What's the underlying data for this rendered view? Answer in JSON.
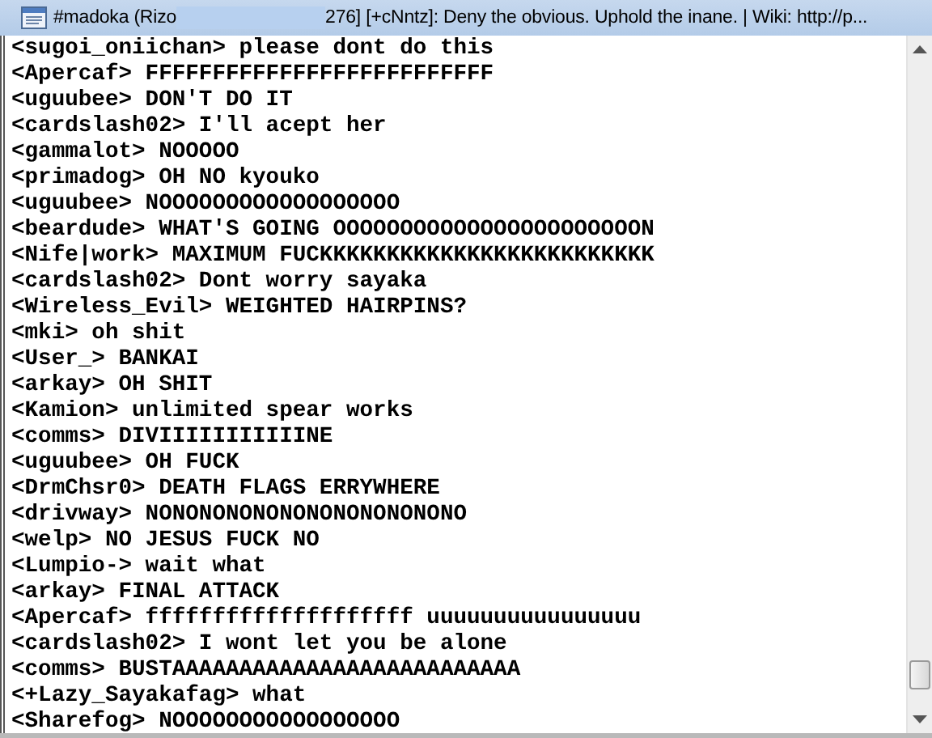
{
  "window": {
    "title_start": "#madoka (Rizo",
    "title_end": "276] [+cNntz]: Deny the obvious. Uphold the inane. | Wiki: http://p..."
  },
  "messages": [
    {
      "nick": "<sugoi_oniichan>",
      "text": "please dont do this"
    },
    {
      "nick": "<Apercaf>",
      "text": "FFFFFFFFFFFFFFFFFFFFFFFFFF"
    },
    {
      "nick": "<uguubee>",
      "text": "DON'T DO IT"
    },
    {
      "nick": "<cardslash02>",
      "text": "I'll acept her"
    },
    {
      "nick": "<gammalot>",
      "text": "NOOOOO"
    },
    {
      "nick": "<primadog>",
      "text": "OH NO kyouko"
    },
    {
      "nick": "<uguubee>",
      "text": "NOOOOOOOOOOOOOOOOOO"
    },
    {
      "nick": "<beardude>",
      "text": "WHAT'S GOING OOOOOOOOOOOOOOOOOOOOOOON"
    },
    {
      "nick": "<Nife|work>",
      "text": "MAXIMUM FUCKKKKKKKKKKKKKKKKKKKKKKKKK"
    },
    {
      "nick": "<cardslash02>",
      "text": "Dont worry sayaka"
    },
    {
      "nick": "<Wireless_Evil>",
      "text": "WEIGHTED HAIRPINS?"
    },
    {
      "nick": "<mki>",
      "text": "oh shit"
    },
    {
      "nick": "<User_>",
      "text": "BANKAI"
    },
    {
      "nick": "<arkay>",
      "text": "OH SHIT"
    },
    {
      "nick": "<Kamion>",
      "text": "unlimited spear works"
    },
    {
      "nick": "<comms>",
      "text": "DIVIIIIIIIIIIINE"
    },
    {
      "nick": "<uguubee>",
      "text": "OH FUCK"
    },
    {
      "nick": "<DrmChsr0>",
      "text": "DEATH FLAGS ERRYWHERE"
    },
    {
      "nick": "<drivway>",
      "text": "NONONONONONONONONONONONO"
    },
    {
      "nick": "<welp>",
      "text": "NO JESUS FUCK NO"
    },
    {
      "nick": "<Lumpio->",
      "text": "wait what"
    },
    {
      "nick": "<arkay>",
      "text": "FINAL ATTACK"
    },
    {
      "nick": "<Apercaf>",
      "text": "ffffffffffffffffffff uuuuuuuuuuuuuuuu"
    },
    {
      "nick": "<cardslash02>",
      "text": "I wont let you be alone"
    },
    {
      "nick": "<comms>",
      "text": "BUSTAAAAAAAAAAAAAAAAAAAAAAAAAA"
    },
    {
      "nick": "<+Lazy_Sayakafag>",
      "text": "what"
    },
    {
      "nick": "<Sharefog>",
      "text": "NOOOOOOOOOOOOOOOOO"
    }
  ]
}
